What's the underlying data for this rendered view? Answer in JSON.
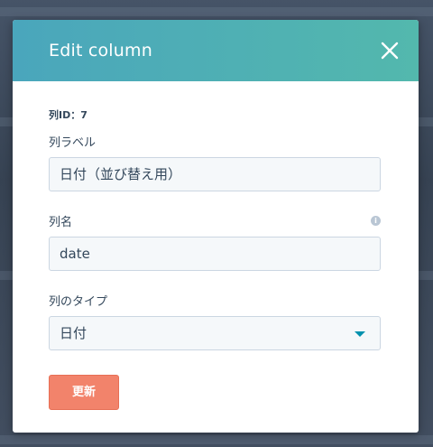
{
  "modal": {
    "title": "Edit column",
    "column_id": "列ID：7",
    "fields": {
      "label": {
        "label": "列ラベル",
        "value": "日付（並び替え用）"
      },
      "name": {
        "label": "列名",
        "value": "date"
      },
      "type": {
        "label": "列のタイプ",
        "value": "日付"
      }
    },
    "submit_label": "更新"
  },
  "icons": {
    "close": "close-icon",
    "info": "info-icon",
    "dropdown": "caret-down-icon"
  },
  "colors": {
    "header_gradient_start": "#4aa6bc",
    "header_gradient_end": "#53b8ad",
    "button": "#f2836b",
    "caret": "#0091ae"
  }
}
